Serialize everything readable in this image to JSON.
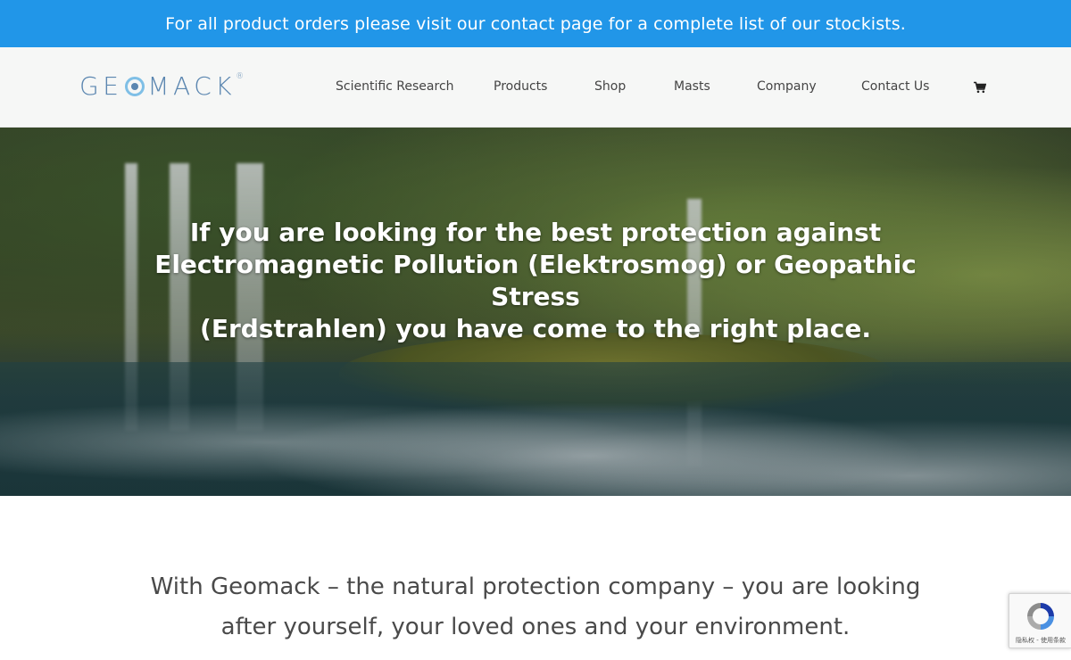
{
  "banner": {
    "text": "For all product orders please visit our contact page for a complete list of our stockists."
  },
  "header": {
    "logo": {
      "part1": "GE",
      "part2": "MACK",
      "reg": "®"
    },
    "nav": [
      {
        "label": "Scientific Research"
      },
      {
        "label": "Products"
      },
      {
        "label": "Shop"
      },
      {
        "label": "Masts"
      },
      {
        "label": "Company"
      },
      {
        "label": "Contact Us"
      }
    ],
    "cart_icon": "shopping-cart-icon"
  },
  "hero": {
    "headline_line1": "If you are looking for the best protection against",
    "headline_line2": "Electromagnetic Pollution (Elektrosmog) or Geopathic Stress",
    "headline_line3": "(Erdstrahlen) you have come to the right place."
  },
  "tagline": {
    "line1": "With Geomack – the natural protection company – you are looking",
    "line2": "after yourself, your loved ones and your environment."
  },
  "recaptcha": {
    "links": "隐私权 - 使用条款"
  },
  "colors": {
    "banner_bg": "#2196e8",
    "logo_blue": "#5b86b0",
    "nav_text": "#444444",
    "tagline_text": "#4a4a4a"
  }
}
